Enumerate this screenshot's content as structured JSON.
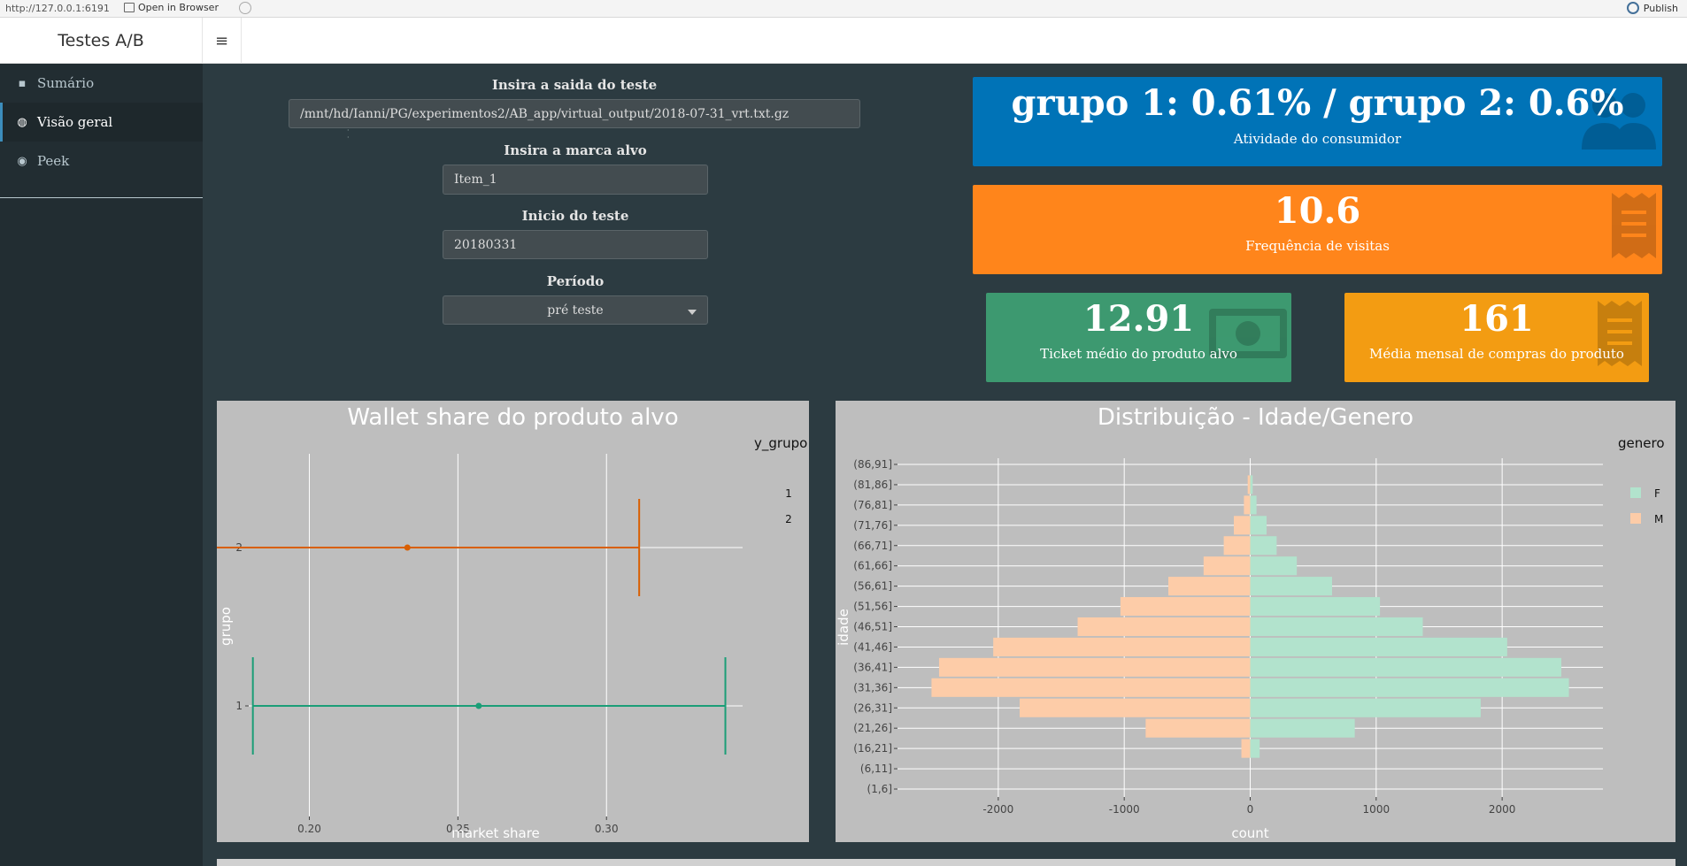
{
  "browser": {
    "url": "http://127.0.0.1:6191",
    "open_label": "Open in Browser",
    "publish_label": "Publish"
  },
  "app": {
    "title": "Testes A/B",
    "toggle_glyph": "≡"
  },
  "sidebar": {
    "items": [
      {
        "label": "Sumário",
        "icon": "sticky-note-icon",
        "glyph": "▪"
      },
      {
        "label": "Visão geral",
        "icon": "globe-icon",
        "glyph": "◍"
      },
      {
        "label": "Peek",
        "icon": "eye-icon",
        "glyph": "◉"
      }
    ],
    "active": "Visão geral"
  },
  "inputs": {
    "output_label": "Insira a saida do teste",
    "output_value": "/mnt/hd/Ianni/PG/experimentos2/AB_app/virtual_output/2018-07-31_vrt.txt.gz",
    "brand_label": "Insira a marca alvo",
    "brand_value": "Item_1",
    "start_label": "Inicio do teste",
    "start_value": "20180331",
    "period_label": "Período",
    "period_value": "pré teste"
  },
  "valueboxes": {
    "activity": {
      "value": "grupo 1: 0.61% / grupo 2: 0.6%",
      "subtitle": "Atividade do consumidor",
      "color": "#0073b7",
      "icon": "users-icon"
    },
    "frequency": {
      "value": "10.6",
      "subtitle": "Frequência de visitas",
      "color": "#ff851b",
      "icon": "receipt-icon"
    },
    "ticket": {
      "value": "12.91",
      "subtitle": "Ticket médio do produto alvo",
      "color": "#3d9970",
      "icon": "money-bill-icon"
    },
    "monthly": {
      "value": "161",
      "subtitle": "Média mensal de compras do produto",
      "color": "#f39c12",
      "icon": "receipt-icon"
    }
  },
  "charts": {
    "wallet": {
      "type": "scatter",
      "title": "Wallet share do produto alvo",
      "xlabel": "market share",
      "ylabel": "grupo",
      "legend_title": "y_grupo",
      "x_ticks": [
        "0.20",
        "0.25",
        "0.30"
      ],
      "y_ticks": [
        "1",
        "2"
      ],
      "legend": [
        {
          "label": "1",
          "color": "#1b9e77"
        },
        {
          "label": "2",
          "color": "#d95f02"
        }
      ],
      "xlim": [
        0.1796,
        0.3458
      ],
      "series": [
        {
          "name": "1",
          "group": 1,
          "estimate": 0.257,
          "lower": 0.181,
          "upper": 0.34,
          "color": "#1b9e77"
        },
        {
          "name": "2",
          "group": 2,
          "estimate": 0.233,
          "lower": 0.167,
          "upper": 0.311,
          "color": "#d95f02"
        }
      ]
    },
    "pyramid": {
      "type": "bar",
      "title": "Distribuição - Idade/Genero",
      "xlabel": "count",
      "ylabel": "idade",
      "legend_title": "genero",
      "legend": [
        {
          "label": "F",
          "color": "#b2e3cd"
        },
        {
          "label": "M",
          "color": "#fdcca8"
        }
      ],
      "x_ticks": [
        "-2000",
        "-1000",
        "0",
        "1000",
        "2000"
      ],
      "xlim": [
        -2800,
        2800
      ],
      "categories": [
        "(1,6]",
        "(6,11]",
        "(16,21]",
        "(21,26]",
        "(26,31]",
        "(31,36]",
        "(36,41]",
        "(41,46]",
        "(46,51]",
        "(51,56]",
        "(56,61]",
        "(61,66]",
        "(66,71]",
        "(71,76]",
        "(76,81]",
        "(81,86]",
        "(86,91]"
      ],
      "series": [
        {
          "name": "F",
          "color": "#b2e3cd",
          "values": [
            0,
            0,
            75,
            830,
            1830,
            2530,
            2470,
            2040,
            1370,
            1030,
            650,
            370,
            210,
            130,
            50,
            20,
            0
          ]
        },
        {
          "name": "M",
          "color": "#fdcca8",
          "values": [
            0,
            0,
            -70,
            -830,
            -1830,
            -2530,
            -2470,
            -2040,
            -1370,
            -1030,
            -650,
            -370,
            -210,
            -130,
            -50,
            -20,
            0
          ]
        }
      ]
    }
  }
}
